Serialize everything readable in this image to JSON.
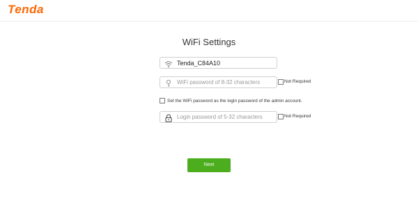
{
  "brand": {
    "logo_text": "Tenda",
    "logo_color": "#ff6600"
  },
  "page": {
    "title": "WiFi Settings"
  },
  "ssid": {
    "value": "Tenda_C84A10",
    "icon": "wifi-icon"
  },
  "wifi_password": {
    "placeholder": "WiFi password of 8-32 characters",
    "icon": "key-icon",
    "not_required_label": "Not Required",
    "not_required_checked": false
  },
  "same_password": {
    "label": "Set the WiFi password as the login password of the admin account.",
    "checked": false
  },
  "login_password": {
    "placeholder": "Login password of 5-32 characters",
    "icon": "lock-icon",
    "not_required_label": "Not Required",
    "not_required_checked": false
  },
  "actions": {
    "next_label": "Next",
    "next_color": "#4cae1e"
  }
}
